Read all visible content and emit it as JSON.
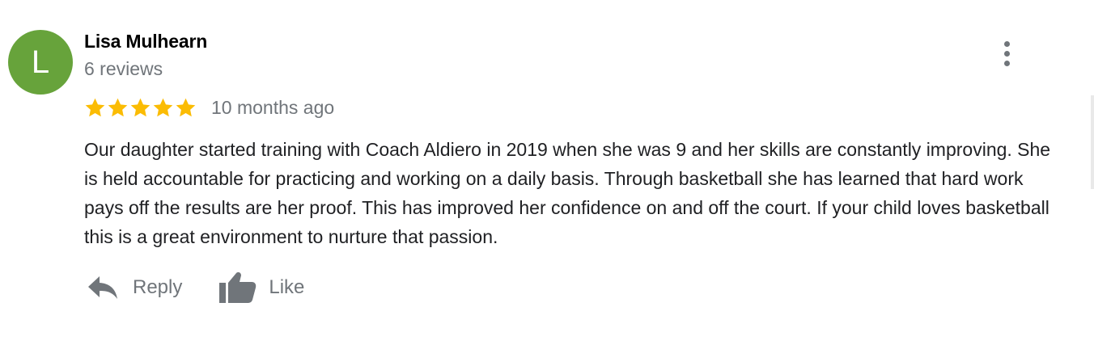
{
  "review": {
    "author": {
      "name": "Lisa Mulhearn",
      "initial": "L",
      "avatar_color": "#67a33b",
      "review_count": "6 reviews"
    },
    "rating": {
      "stars": 5,
      "max_stars": 5,
      "star_color": "#fbbc04"
    },
    "time_ago": "10 months ago",
    "text": "Our daughter started training with Coach Aldiero in 2019 when she was 9 and her skills are constantly improving. She is held accountable for practicing and working on a daily basis. Through basketball she has learned that hard work pays off the results are her proof. This has improved her confidence on and off the court. If your child loves basketball this is a great environment to nurture that passion.",
    "menu_icon": "more-vert-icon",
    "actions": {
      "reply_label": "Reply",
      "reply_icon": "reply-icon",
      "like_label": "Like",
      "like_icon": "thumbs-up-icon",
      "icon_color": "#70757a"
    }
  }
}
